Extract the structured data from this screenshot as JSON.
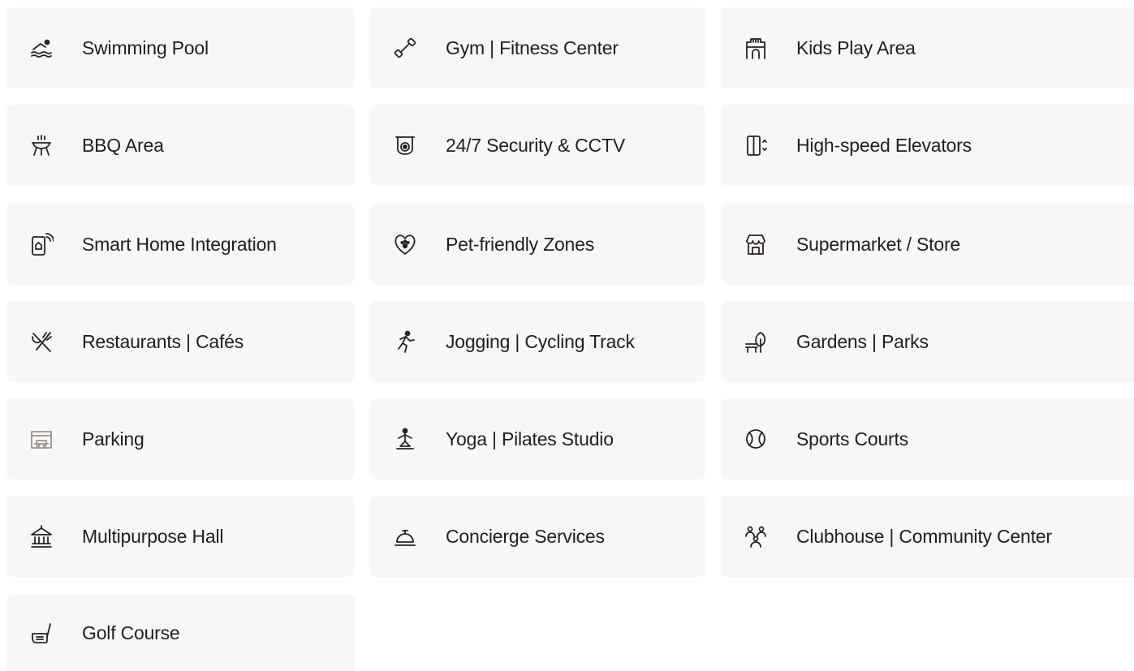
{
  "amenities": [
    {
      "label": "Swimming Pool",
      "icon": "swimming-pool-icon"
    },
    {
      "label": "Gym | Fitness Center",
      "icon": "dumbbell-icon"
    },
    {
      "label": "Kids Play Area",
      "icon": "play-castle-icon"
    },
    {
      "label": "BBQ Area",
      "icon": "bbq-grill-icon"
    },
    {
      "label": "24/7 Security & CCTV",
      "icon": "cctv-camera-icon"
    },
    {
      "label": "High-speed Elevators",
      "icon": "elevator-icon"
    },
    {
      "label": "Smart Home Integration",
      "icon": "smart-home-phone-icon"
    },
    {
      "label": "Pet-friendly Zones",
      "icon": "pet-heart-paw-icon"
    },
    {
      "label": "Supermarket / Store",
      "icon": "store-awning-icon"
    },
    {
      "label": "Restaurants | Cafés",
      "icon": "fork-knife-icon"
    },
    {
      "label": "Jogging | Cycling Track",
      "icon": "runner-icon"
    },
    {
      "label": "Gardens | Parks",
      "icon": "park-bench-tree-icon"
    },
    {
      "label": "Parking",
      "icon": "parking-garage-icon"
    },
    {
      "label": "Yoga | Pilates Studio",
      "icon": "yoga-pose-icon"
    },
    {
      "label": "Sports Courts",
      "icon": "sports-ball-icon"
    },
    {
      "label": "Multipurpose Hall",
      "icon": "hall-building-icon"
    },
    {
      "label": "Concierge Services",
      "icon": "concierge-bell-icon"
    },
    {
      "label": "Clubhouse | Community Center",
      "icon": "community-people-icon"
    },
    {
      "label": "Golf Course",
      "icon": "golf-club-icon"
    }
  ],
  "colors": {
    "card_background": "#f7f7f7",
    "icon_stroke": "#2a2320",
    "text": "#1f1f1f"
  }
}
